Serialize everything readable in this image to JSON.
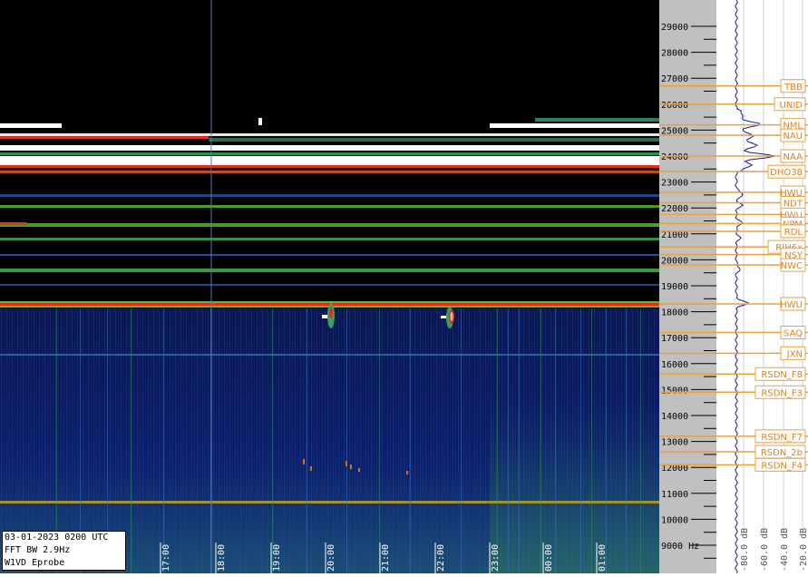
{
  "info": {
    "date_line": "03-01-2023 0200 UTC",
    "fft_line": "FFT BW 2.9Hz",
    "station_line": "W1VD Eprobe"
  },
  "colors": {
    "background_band": "#000000",
    "noise_floor": "#0a1a5a",
    "signal_high": "#ffffff",
    "signal_red": "#e03020",
    "signal_green": "#60b040",
    "marker_orange": "#e8a040",
    "scale_grey": "#c0c0c0",
    "spectrum_line": "#1a1a8a"
  },
  "time_axis": {
    "labels": [
      "17:00",
      "18:00",
      "19:00",
      "20:00",
      "21:00",
      "22:00",
      "23:00",
      "00:00",
      "01:00"
    ]
  },
  "freq_axis": {
    "unit": "Hz",
    "labels": [
      "29000",
      "28000",
      "27000",
      "26000",
      "25000",
      "24000",
      "23000",
      "22000",
      "21000",
      "20000",
      "19000",
      "18000",
      "17000",
      "16000",
      "15000",
      "14000",
      "13000",
      "12000",
      "11000",
      "10000",
      "9000"
    ]
  },
  "db_axis": {
    "labels": [
      "-80.0 dB",
      "-60.0 dB",
      "-40.0 dB",
      "-20.0 dB"
    ]
  },
  "stations": [
    {
      "name": "TBB",
      "freq": 26700
    },
    {
      "name": "UNID",
      "freq": 26000
    },
    {
      "name": "NML",
      "freq": 25200
    },
    {
      "name": "NAU",
      "freq": 24800
    },
    {
      "name": "NAA",
      "freq": 24000
    },
    {
      "name": "DHO38",
      "freq": 23400
    },
    {
      "name": "HWU",
      "freq": 22600
    },
    {
      "name": "NDT",
      "freq": 22200
    },
    {
      "name": "HWU",
      "freq": 21750
    },
    {
      "name": "NPM",
      "freq": 21400
    },
    {
      "name": "RDL",
      "freq": 21100
    },
    {
      "name": "RJH6x",
      "freq": 20500
    },
    {
      "name": "NSY",
      "freq": 20200
    },
    {
      "name": "NWC",
      "freq": 19800
    },
    {
      "name": "HWU",
      "freq": 18300
    },
    {
      "name": "SAQ",
      "freq": 17200
    },
    {
      "name": "JXN",
      "freq": 16400
    },
    {
      "name": "RSDN_F8",
      "freq": 15600
    },
    {
      "name": "RSDN_F3",
      "freq": 14900
    },
    {
      "name": "RSDN_F7",
      "freq": 13200
    },
    {
      "name": "RSDN_2b",
      "freq": 12600
    },
    {
      "name": "RSDN_F4",
      "freq": 12100
    }
  ]
}
